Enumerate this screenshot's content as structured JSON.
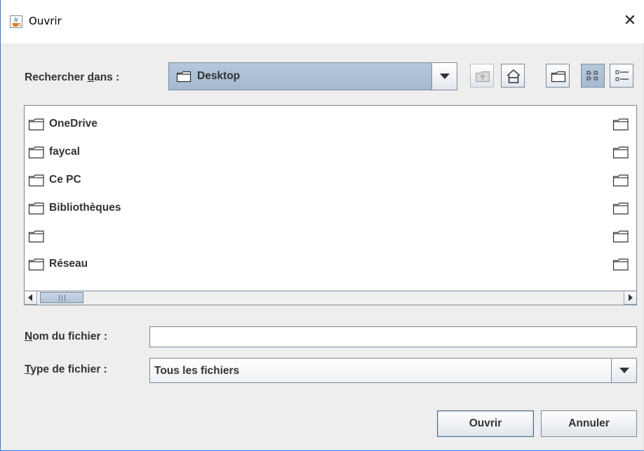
{
  "window": {
    "title": "Ouvrir",
    "icon": "java-cup-icon",
    "close_glyph": "✕"
  },
  "lookin": {
    "label_prefix": "Rechercher ",
    "label_mnemonic": "d",
    "label_suffix": "ans :",
    "current": "Desktop",
    "current_icon": "folder-icon"
  },
  "toolbar": {
    "buttons": [
      {
        "name": "up-one-level-button",
        "icon": "folder-up-icon",
        "enabled": false
      },
      {
        "name": "home-button",
        "icon": "home-icon",
        "enabled": true
      },
      {
        "name": "new-folder-button",
        "icon": "new-folder-icon",
        "enabled": true
      },
      {
        "name": "list-view-button",
        "icon": "list-view-icon",
        "selected": true
      },
      {
        "name": "details-view-button",
        "icon": "details-view-icon",
        "selected": false
      }
    ]
  },
  "files": [
    {
      "label": "OneDrive",
      "icon": "folder-icon"
    },
    {
      "label": "faycal",
      "icon": "folder-icon"
    },
    {
      "label": "Ce PC",
      "icon": "folder-icon"
    },
    {
      "label": "Bibliothèques",
      "icon": "folder-icon"
    },
    {
      "label": "",
      "icon": "folder-icon"
    },
    {
      "label": "Réseau",
      "icon": "folder-icon"
    }
  ],
  "filename": {
    "label_mnemonic": "N",
    "label_rest": "om du fichier :",
    "value": "",
    "placeholder": ""
  },
  "filetype": {
    "label_mnemonic": "T",
    "label_rest": "ype de fichier :",
    "selected": "Tous les fichiers"
  },
  "buttons": {
    "open": "Ouvrir",
    "cancel": "Annuler"
  },
  "colors": {
    "window_border": "#2c7be5",
    "selection_fill": "#b5c7db",
    "control_border": "#7a8a99",
    "dialog_bg": "#eeeeee"
  }
}
